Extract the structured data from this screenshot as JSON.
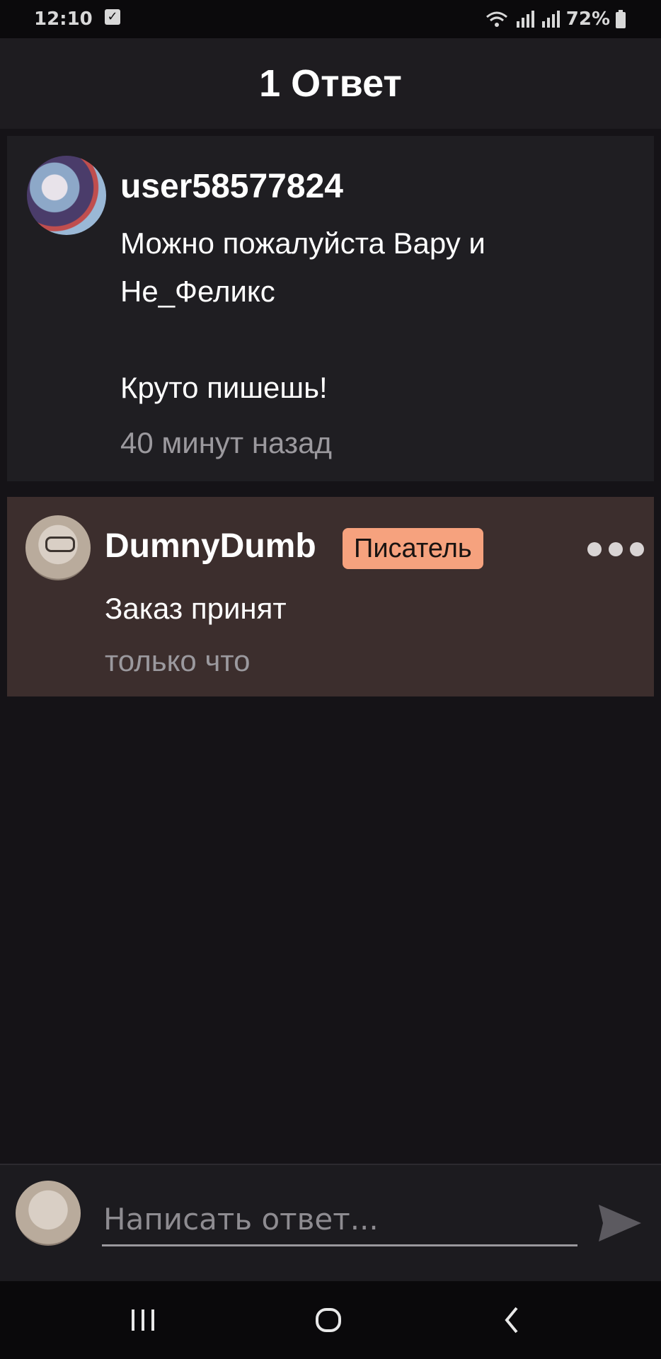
{
  "status_bar": {
    "time": "12:10",
    "notification_icon": "check-icon",
    "battery": "72%"
  },
  "header": {
    "title": "1 Ответ"
  },
  "original_comment": {
    "username": "user58577824",
    "text": "Можно пожалуйста  Вару и\nНе_Феликс\n\nКруто пишешь!",
    "time": "40 минут назад"
  },
  "reply": {
    "username": "DumnyDumb",
    "badge": "Писатель",
    "text": "Заказ принят",
    "time": "только что"
  },
  "composer": {
    "placeholder": "Написать ответ..."
  },
  "colors": {
    "background": "#151317",
    "reply_background": "#3c2e2d",
    "badge": "#f6a27e"
  }
}
